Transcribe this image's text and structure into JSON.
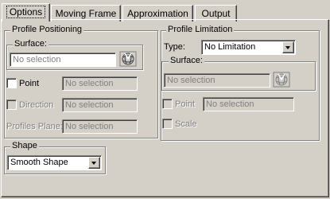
{
  "tabs": [
    {
      "label": "Options",
      "active": true
    },
    {
      "label": "Moving Frame",
      "active": false
    },
    {
      "label": "Approximation",
      "active": false
    },
    {
      "label": "Output",
      "active": false
    }
  ],
  "profile_positioning": {
    "title": "Profile Positioning",
    "surface_group": {
      "title": "Surface:",
      "value": "No selection"
    },
    "point": {
      "label": "Point",
      "value": "No selection"
    },
    "direction": {
      "label": "Direction",
      "value": "No selection"
    },
    "profiles_plane": {
      "label": "Profiles Plane:",
      "value": "No selection"
    }
  },
  "shape": {
    "title": "Shape",
    "selected": "Smooth Shape"
  },
  "profile_limitation": {
    "title": "Profile Limitation",
    "type_label": "Type:",
    "type_value": "No Limitation",
    "surface_group": {
      "title": "Surface:",
      "value": "No selection"
    },
    "point": {
      "label": "Point",
      "value": "No selection"
    },
    "scale": {
      "label": "Scale"
    }
  },
  "icons": {
    "selector": "surface-selector-icon",
    "dropdown": "chevron-down-icon"
  }
}
